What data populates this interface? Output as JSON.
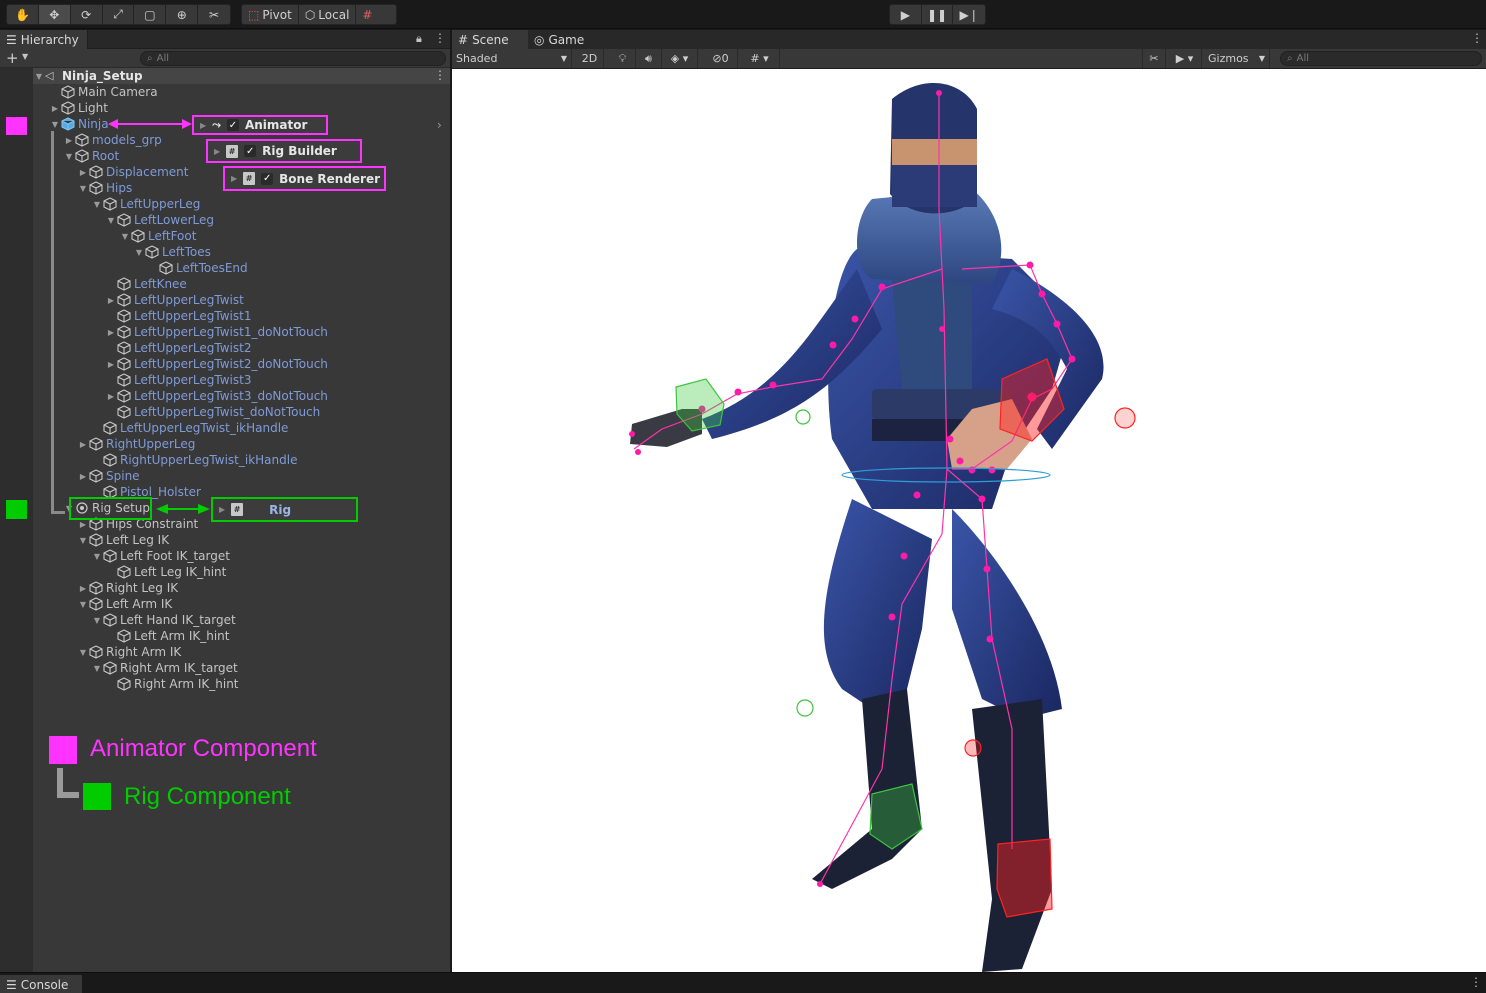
{
  "toolbar": {
    "tools": [
      "hand-tool",
      "move-tool",
      "rotate-tool",
      "scale-tool",
      "rect-tool",
      "transform-tool",
      "custom-tool"
    ],
    "pivot_label": "Pivot",
    "local_label": "Local"
  },
  "hierarchy": {
    "tab_label": "Hierarchy",
    "search_placeholder": "All",
    "scene_name": "Ninja_Setup",
    "items": [
      {
        "label": "Main Camera",
        "blue": false
      },
      {
        "label": "Light",
        "blue": false
      },
      {
        "label": "Ninja",
        "blue": true
      },
      {
        "label": "models_grp",
        "blue": true
      },
      {
        "label": "Root",
        "blue": true
      },
      {
        "label": "Displacement",
        "blue": true
      },
      {
        "label": "Hips",
        "blue": true
      },
      {
        "label": "LeftUpperLeg",
        "blue": true
      },
      {
        "label": "LeftLowerLeg",
        "blue": true
      },
      {
        "label": "LeftFoot",
        "blue": true
      },
      {
        "label": "LeftToes",
        "blue": true
      },
      {
        "label": "LeftToesEnd",
        "blue": true
      },
      {
        "label": "LeftKnee",
        "blue": true
      },
      {
        "label": "LeftUpperLegTwist",
        "blue": true
      },
      {
        "label": "LeftUpperLegTwist1",
        "blue": true
      },
      {
        "label": "LeftUpperLegTwist1_doNotTouch",
        "blue": true
      },
      {
        "label": "LeftUpperLegTwist2",
        "blue": true
      },
      {
        "label": "LeftUpperLegTwist2_doNotTouch",
        "blue": true
      },
      {
        "label": "LeftUpperLegTwist3",
        "blue": true
      },
      {
        "label": "LeftUpperLegTwist3_doNotTouch",
        "blue": true
      },
      {
        "label": "LeftUpperLegTwist_doNotTouch",
        "blue": true
      },
      {
        "label": "LeftUpperLegTwist_ikHandle",
        "blue": true
      },
      {
        "label": "RightUpperLeg",
        "blue": true
      },
      {
        "label": "RightUpperLegTwist_ikHandle",
        "blue": true
      },
      {
        "label": "Spine",
        "blue": true
      },
      {
        "label": "Pistol_Holster",
        "blue": true
      },
      {
        "label": "Rig Setup",
        "blue": false
      },
      {
        "label": "Hips Constraint",
        "blue": false
      },
      {
        "label": "Left Leg IK",
        "blue": false
      },
      {
        "label": "Left Foot IK_target",
        "blue": false
      },
      {
        "label": "Left Leg IK_hint",
        "blue": false
      },
      {
        "label": "Right Leg IK",
        "blue": false
      },
      {
        "label": "Left Arm IK",
        "blue": false
      },
      {
        "label": "Left Hand IK_target",
        "blue": false
      },
      {
        "label": "Left Arm IK_hint",
        "blue": false
      },
      {
        "label": "Right Arm IK",
        "blue": false
      },
      {
        "label": "Right Arm IK_target",
        "blue": false
      },
      {
        "label": "Right Arm IK_hint",
        "blue": false
      }
    ]
  },
  "components": {
    "animator": "Animator",
    "rig_builder": "Rig Builder",
    "bone_renderer": "Bone Renderer",
    "rig": "Rig"
  },
  "legend": {
    "animator_label": "Animator Component",
    "rig_label": "Rig Component",
    "animator_color": "#ff33ff",
    "rig_color": "#00cc00"
  },
  "scene": {
    "scene_tab": "Scene",
    "game_tab": "Game",
    "shading_mode": "Shaded",
    "mode_2d": "2D",
    "hidden_count": "0",
    "gizmos_label": "Gizmos",
    "search_placeholder": "All"
  },
  "bottom": {
    "console_tab": "Console"
  }
}
